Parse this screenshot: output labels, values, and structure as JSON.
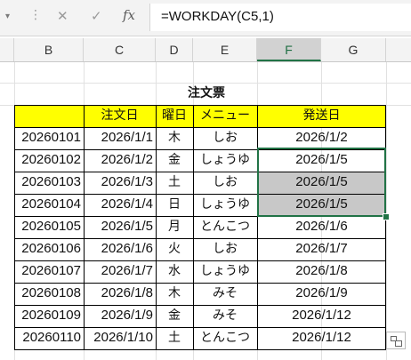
{
  "formula_bar": {
    "name_box_arrow": "▾",
    "dots": "⋮",
    "cancel_icon": "✕",
    "enter_icon": "✓",
    "fx_label": "fx",
    "formula": "=WORKDAY(C5,1)"
  },
  "columns": [
    "B",
    "C",
    "D",
    "E",
    "F",
    "G"
  ],
  "selected_columns": [
    "F"
  ],
  "table": {
    "title": "注文票",
    "headers": [
      "",
      "注文日",
      "曜日",
      "メニュー",
      "発送日"
    ],
    "rows": [
      {
        "id": "20260101",
        "order_date": "2026/1/1",
        "weekday": "木",
        "menu": "しお",
        "ship_date": "2026/1/2"
      },
      {
        "id": "20260102",
        "order_date": "2026/1/2",
        "weekday": "金",
        "menu": "しょうゆ",
        "ship_date": "2026/1/5"
      },
      {
        "id": "20260103",
        "order_date": "2026/1/3",
        "weekday": "土",
        "menu": "しお",
        "ship_date": "2026/1/5"
      },
      {
        "id": "20260104",
        "order_date": "2026/1/4",
        "weekday": "日",
        "menu": "しょうゆ",
        "ship_date": "2026/1/5"
      },
      {
        "id": "20260105",
        "order_date": "2026/1/5",
        "weekday": "月",
        "menu": "とんこつ",
        "ship_date": "2026/1/6"
      },
      {
        "id": "20260106",
        "order_date": "2026/1/6",
        "weekday": "火",
        "menu": "しお",
        "ship_date": "2026/1/7"
      },
      {
        "id": "20260107",
        "order_date": "2026/1/7",
        "weekday": "水",
        "menu": "しょうゆ",
        "ship_date": "2026/1/8"
      },
      {
        "id": "20260108",
        "order_date": "2026/1/8",
        "weekday": "木",
        "menu": "みそ",
        "ship_date": "2026/1/9"
      },
      {
        "id": "20260109",
        "order_date": "2026/1/9",
        "weekday": "金",
        "menu": "みそ",
        "ship_date": "2026/1/12"
      },
      {
        "id": "20260110",
        "order_date": "2026/1/10",
        "weekday": "土",
        "menu": "とんこつ",
        "ship_date": "2026/1/12"
      }
    ]
  },
  "selection": {
    "start_row_index": 1,
    "end_row_index": 3,
    "shaded_row_indices": [
      2,
      3
    ]
  },
  "colors": {
    "header_fill": "#ffff00",
    "selection_border": "#217346",
    "shade_fill": "#c8c8c8"
  },
  "icons": {
    "quick_analysis": "quick-analysis-icon"
  }
}
